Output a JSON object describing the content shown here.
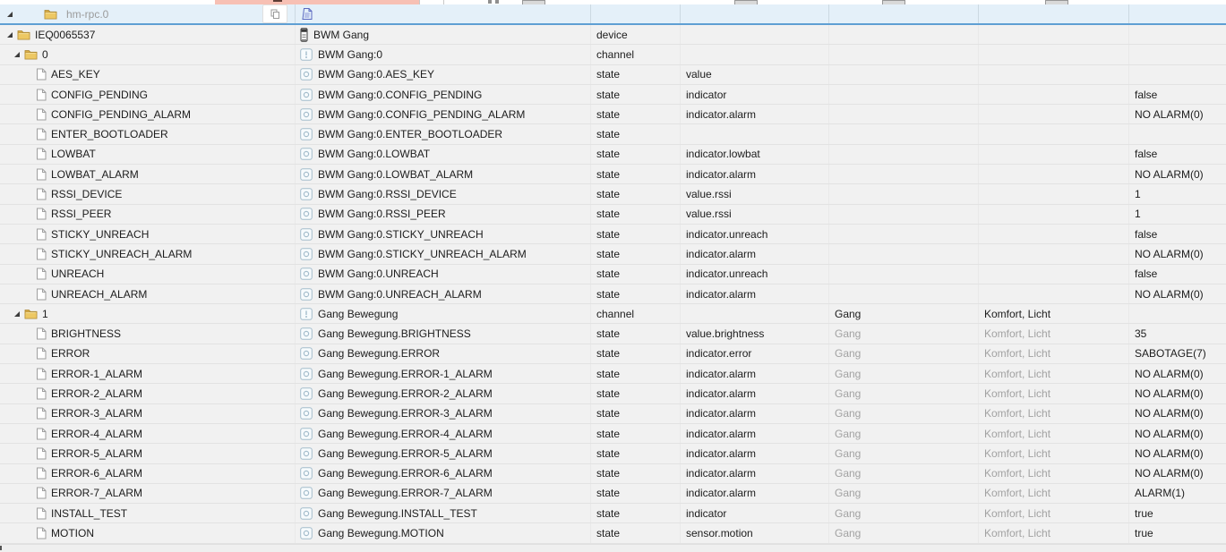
{
  "colors": {
    "selected_row_bg": "#e4f0f9",
    "selected_row_border": "#5f9fd3",
    "table_bg": "#f1f1f1",
    "inherited_text": "#a2a2a2",
    "muted_text": "#9b9b9b",
    "pink_highlight": "#f7c0b4",
    "folder_gold": "#e9c05a",
    "object_icon_blue": "#a4bdcc",
    "doc_icon_blue": "#5a68c0"
  },
  "root": {
    "label": "hm-rpc.0"
  },
  "table": {
    "rows": [
      {
        "indent": 1,
        "expander": true,
        "tree_icon": "folder",
        "label": "IEQ0065537",
        "type_icon": "device",
        "name": "BWM Gang",
        "type": "device",
        "role": "",
        "room": "",
        "room_inherited": false,
        "function": "",
        "function_inherited": false,
        "value": ""
      },
      {
        "indent": 2,
        "expander": true,
        "tree_icon": "folder",
        "label": "0",
        "type_icon": "channel",
        "name": "BWM Gang:0",
        "type": "channel",
        "role": "",
        "room": "",
        "room_inherited": false,
        "function": "",
        "function_inherited": false,
        "value": ""
      },
      {
        "indent": 3,
        "expander": false,
        "tree_icon": "file",
        "label": "AES_KEY",
        "type_icon": "state",
        "name": "BWM Gang:0.AES_KEY",
        "type": "state",
        "role": "value",
        "room": "",
        "room_inherited": false,
        "function": "",
        "function_inherited": false,
        "value": ""
      },
      {
        "indent": 3,
        "expander": false,
        "tree_icon": "file",
        "label": "CONFIG_PENDING",
        "type_icon": "state",
        "name": "BWM Gang:0.CONFIG_PENDING",
        "type": "state",
        "role": "indicator",
        "room": "",
        "room_inherited": false,
        "function": "",
        "function_inherited": false,
        "value": "false"
      },
      {
        "indent": 3,
        "expander": false,
        "tree_icon": "file",
        "label": "CONFIG_PENDING_ALARM",
        "type_icon": "state",
        "name": "BWM Gang:0.CONFIG_PENDING_ALARM",
        "type": "state",
        "role": "indicator.alarm",
        "room": "",
        "room_inherited": false,
        "function": "",
        "function_inherited": false,
        "value": "NO ALARM(0)"
      },
      {
        "indent": 3,
        "expander": false,
        "tree_icon": "file",
        "label": "ENTER_BOOTLOADER",
        "type_icon": "state",
        "name": "BWM Gang:0.ENTER_BOOTLOADER",
        "type": "state",
        "role": "",
        "room": "",
        "room_inherited": false,
        "function": "",
        "function_inherited": false,
        "value": ""
      },
      {
        "indent": 3,
        "expander": false,
        "tree_icon": "file",
        "label": "LOWBAT",
        "type_icon": "state",
        "name": "BWM Gang:0.LOWBAT",
        "type": "state",
        "role": "indicator.lowbat",
        "room": "",
        "room_inherited": false,
        "function": "",
        "function_inherited": false,
        "value": "false"
      },
      {
        "indent": 3,
        "expander": false,
        "tree_icon": "file",
        "label": "LOWBAT_ALARM",
        "type_icon": "state",
        "name": "BWM Gang:0.LOWBAT_ALARM",
        "type": "state",
        "role": "indicator.alarm",
        "room": "",
        "room_inherited": false,
        "function": "",
        "function_inherited": false,
        "value": "NO ALARM(0)"
      },
      {
        "indent": 3,
        "expander": false,
        "tree_icon": "file",
        "label": "RSSI_DEVICE",
        "type_icon": "state",
        "name": "BWM Gang:0.RSSI_DEVICE",
        "type": "state",
        "role": "value.rssi",
        "room": "",
        "room_inherited": false,
        "function": "",
        "function_inherited": false,
        "value": "1"
      },
      {
        "indent": 3,
        "expander": false,
        "tree_icon": "file",
        "label": "RSSI_PEER",
        "type_icon": "state",
        "name": "BWM Gang:0.RSSI_PEER",
        "type": "state",
        "role": "value.rssi",
        "room": "",
        "room_inherited": false,
        "function": "",
        "function_inherited": false,
        "value": "1"
      },
      {
        "indent": 3,
        "expander": false,
        "tree_icon": "file",
        "label": "STICKY_UNREACH",
        "type_icon": "state",
        "name": "BWM Gang:0.STICKY_UNREACH",
        "type": "state",
        "role": "indicator.unreach",
        "room": "",
        "room_inherited": false,
        "function": "",
        "function_inherited": false,
        "value": "false"
      },
      {
        "indent": 3,
        "expander": false,
        "tree_icon": "file",
        "label": "STICKY_UNREACH_ALARM",
        "type_icon": "state",
        "name": "BWM Gang:0.STICKY_UNREACH_ALARM",
        "type": "state",
        "role": "indicator.alarm",
        "room": "",
        "room_inherited": false,
        "function": "",
        "function_inherited": false,
        "value": "NO ALARM(0)"
      },
      {
        "indent": 3,
        "expander": false,
        "tree_icon": "file",
        "label": "UNREACH",
        "type_icon": "state",
        "name": "BWM Gang:0.UNREACH",
        "type": "state",
        "role": "indicator.unreach",
        "room": "",
        "room_inherited": false,
        "function": "",
        "function_inherited": false,
        "value": "false"
      },
      {
        "indent": 3,
        "expander": false,
        "tree_icon": "file",
        "label": "UNREACH_ALARM",
        "type_icon": "state",
        "name": "BWM Gang:0.UNREACH_ALARM",
        "type": "state",
        "role": "indicator.alarm",
        "room": "",
        "room_inherited": false,
        "function": "",
        "function_inherited": false,
        "value": "NO ALARM(0)"
      },
      {
        "indent": 2,
        "expander": true,
        "tree_icon": "folder",
        "label": "1",
        "type_icon": "channel",
        "name": "Gang Bewegung",
        "type": "channel",
        "role": "",
        "room": "Gang",
        "room_inherited": false,
        "function": "Komfort, Licht",
        "function_inherited": false,
        "value": ""
      },
      {
        "indent": 3,
        "expander": false,
        "tree_icon": "file",
        "label": "BRIGHTNESS",
        "type_icon": "state",
        "name": "Gang Bewegung.BRIGHTNESS",
        "type": "state",
        "role": "value.brightness",
        "room": "Gang",
        "room_inherited": true,
        "function": "Komfort, Licht",
        "function_inherited": true,
        "value": "35"
      },
      {
        "indent": 3,
        "expander": false,
        "tree_icon": "file",
        "label": "ERROR",
        "type_icon": "state",
        "name": "Gang Bewegung.ERROR",
        "type": "state",
        "role": "indicator.error",
        "room": "Gang",
        "room_inherited": true,
        "function": "Komfort, Licht",
        "function_inherited": true,
        "value": "SABOTAGE(7)"
      },
      {
        "indent": 3,
        "expander": false,
        "tree_icon": "file",
        "label": "ERROR-1_ALARM",
        "type_icon": "state",
        "name": "Gang Bewegung.ERROR-1_ALARM",
        "type": "state",
        "role": "indicator.alarm",
        "room": "Gang",
        "room_inherited": true,
        "function": "Komfort, Licht",
        "function_inherited": true,
        "value": "NO ALARM(0)"
      },
      {
        "indent": 3,
        "expander": false,
        "tree_icon": "file",
        "label": "ERROR-2_ALARM",
        "type_icon": "state",
        "name": "Gang Bewegung.ERROR-2_ALARM",
        "type": "state",
        "role": "indicator.alarm",
        "room": "Gang",
        "room_inherited": true,
        "function": "Komfort, Licht",
        "function_inherited": true,
        "value": "NO ALARM(0)"
      },
      {
        "indent": 3,
        "expander": false,
        "tree_icon": "file",
        "label": "ERROR-3_ALARM",
        "type_icon": "state",
        "name": "Gang Bewegung.ERROR-3_ALARM",
        "type": "state",
        "role": "indicator.alarm",
        "room": "Gang",
        "room_inherited": true,
        "function": "Komfort, Licht",
        "function_inherited": true,
        "value": "NO ALARM(0)"
      },
      {
        "indent": 3,
        "expander": false,
        "tree_icon": "file",
        "label": "ERROR-4_ALARM",
        "type_icon": "state",
        "name": "Gang Bewegung.ERROR-4_ALARM",
        "type": "state",
        "role": "indicator.alarm",
        "room": "Gang",
        "room_inherited": true,
        "function": "Komfort, Licht",
        "function_inherited": true,
        "value": "NO ALARM(0)"
      },
      {
        "indent": 3,
        "expander": false,
        "tree_icon": "file",
        "label": "ERROR-5_ALARM",
        "type_icon": "state",
        "name": "Gang Bewegung.ERROR-5_ALARM",
        "type": "state",
        "role": "indicator.alarm",
        "room": "Gang",
        "room_inherited": true,
        "function": "Komfort, Licht",
        "function_inherited": true,
        "value": "NO ALARM(0)"
      },
      {
        "indent": 3,
        "expander": false,
        "tree_icon": "file",
        "label": "ERROR-6_ALARM",
        "type_icon": "state",
        "name": "Gang Bewegung.ERROR-6_ALARM",
        "type": "state",
        "role": "indicator.alarm",
        "room": "Gang",
        "room_inherited": true,
        "function": "Komfort, Licht",
        "function_inherited": true,
        "value": "NO ALARM(0)"
      },
      {
        "indent": 3,
        "expander": false,
        "tree_icon": "file",
        "label": "ERROR-7_ALARM",
        "type_icon": "state",
        "name": "Gang Bewegung.ERROR-7_ALARM",
        "type": "state",
        "role": "indicator.alarm",
        "room": "Gang",
        "room_inherited": true,
        "function": "Komfort, Licht",
        "function_inherited": true,
        "value": "ALARM(1)"
      },
      {
        "indent": 3,
        "expander": false,
        "tree_icon": "file",
        "label": "INSTALL_TEST",
        "type_icon": "state",
        "name": "Gang Bewegung.INSTALL_TEST",
        "type": "state",
        "role": "indicator",
        "room": "Gang",
        "room_inherited": true,
        "function": "Komfort, Licht",
        "function_inherited": true,
        "value": "true"
      },
      {
        "indent": 3,
        "expander": false,
        "tree_icon": "file",
        "label": "MOTION",
        "type_icon": "state",
        "name": "Gang Bewegung.MOTION",
        "type": "state",
        "role": "sensor.motion",
        "room": "Gang",
        "room_inherited": true,
        "function": "Komfort, Licht",
        "function_inherited": true,
        "value": "true"
      }
    ]
  }
}
